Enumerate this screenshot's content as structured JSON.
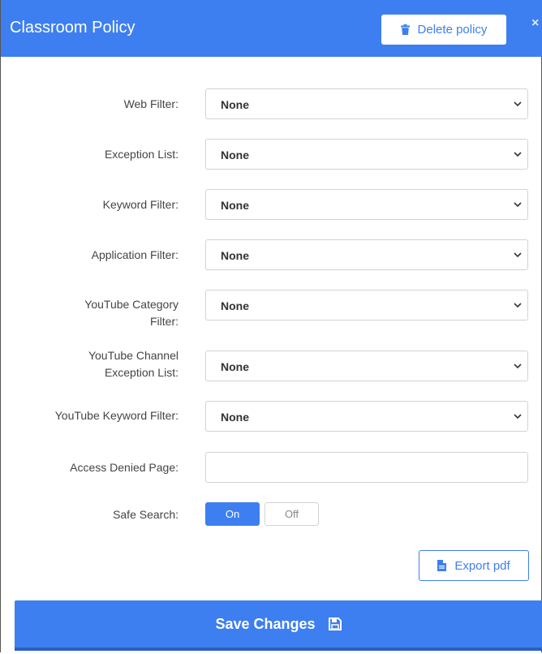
{
  "header": {
    "title": "Classroom Policy",
    "delete_label": "Delete policy",
    "close_glyph": "×"
  },
  "fields": [
    {
      "label": "Web Filter:",
      "value": "None"
    },
    {
      "label": "Exception List:",
      "value": "None"
    },
    {
      "label": "Keyword Filter:",
      "value": "None"
    },
    {
      "label": "Application Filter:",
      "value": "None"
    },
    {
      "label_line1": "YouTube Category",
      "label_line2": "Filter:",
      "value": "None"
    },
    {
      "label_line1": "YouTube Channel",
      "label_line2": "Exception List:",
      "value": "None"
    },
    {
      "label": "YouTube Keyword Filter:",
      "value": "None"
    }
  ],
  "access_denied": {
    "label": "Access Denied Page:",
    "value": ""
  },
  "safe_search": {
    "label": "Safe Search:",
    "on_label": "On",
    "off_label": "Off",
    "selected": "On"
  },
  "export_label": "Export pdf",
  "save_label": "Save Changes",
  "icons": {
    "delete": "trash-icon",
    "close": "close-icon",
    "select": "chevron-down-icon",
    "export": "document-icon",
    "save": "floppy-disk-icon"
  },
  "colors": {
    "accent": "#3d7ff0",
    "header_text": "#ffffff"
  }
}
